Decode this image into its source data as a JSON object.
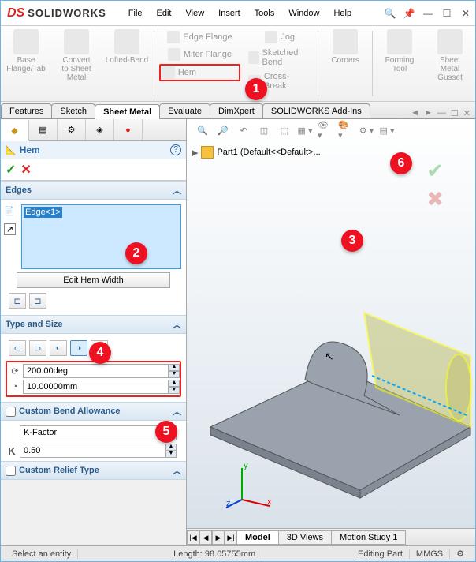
{
  "app": {
    "brand_prefix": "DS",
    "name": "SOLIDWORKS"
  },
  "menu": [
    "File",
    "Edit",
    "View",
    "Insert",
    "Tools",
    "Window",
    "Help"
  ],
  "ribbon": {
    "large": [
      {
        "label": "Base\nFlange/Tab"
      },
      {
        "label": "Convert\nto Sheet\nMetal"
      },
      {
        "label": "Lofted-Bend"
      },
      {
        "label": "Corners"
      },
      {
        "label": "Forming\nTool"
      },
      {
        "label": "Sheet\nMetal\nGusset"
      }
    ],
    "stack1": [
      "Edge Flange",
      "Miter Flange",
      "Hem"
    ],
    "stack2": [
      "Jog",
      "Sketched Bend",
      "Cross-Break"
    ]
  },
  "tabs": [
    "Features",
    "Sketch",
    "Sheet Metal",
    "Evaluate",
    "DimXpert",
    "SOLIDWORKS Add-Ins"
  ],
  "active_tab": "Sheet Metal",
  "feature": {
    "name": "Hem"
  },
  "edges": {
    "title": "Edges",
    "items": [
      "Edge<1>"
    ],
    "edit_width": "Edit Hem Width"
  },
  "type_size": {
    "title": "Type and Size",
    "angle": "200.00deg",
    "radius": "10.00000mm"
  },
  "cba": {
    "label": "Custom Bend Allowance",
    "option": "K-Factor",
    "value": "0.50",
    "symbol": "K"
  },
  "crt": {
    "label": "Custom Relief Type"
  },
  "tree": {
    "label": "Part1 (Default<<Default>..."
  },
  "bottom_tabs": [
    "Model",
    "3D Views",
    "Motion Study 1"
  ],
  "status": {
    "prompt": "Select an entity",
    "length": "Length: 98.05755mm",
    "mode": "Editing Part",
    "units": "MMGS"
  },
  "callouts": {
    "1": "1",
    "2": "2",
    "3": "3",
    "4": "4",
    "5": "5",
    "6": "6"
  }
}
